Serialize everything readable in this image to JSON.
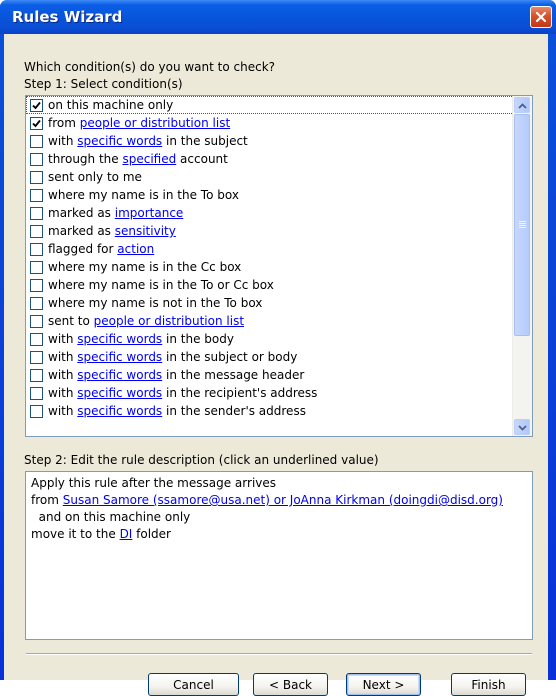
{
  "window": {
    "title": "Rules Wizard"
  },
  "prompt": "Which condition(s) do you want to check?",
  "step1": {
    "label": "Step 1: Select condition(s)"
  },
  "conditions": [
    {
      "checked": true,
      "parts": [
        "on this machine only"
      ]
    },
    {
      "checked": true,
      "parts": [
        "from ",
        {
          "link": "people or distribution list"
        }
      ]
    },
    {
      "checked": false,
      "parts": [
        "with ",
        {
          "link": "specific words"
        },
        " in the subject"
      ]
    },
    {
      "checked": false,
      "parts": [
        "through the ",
        {
          "link": "specified"
        },
        " account"
      ]
    },
    {
      "checked": false,
      "parts": [
        "sent only to me"
      ]
    },
    {
      "checked": false,
      "parts": [
        "where my name is in the To box"
      ]
    },
    {
      "checked": false,
      "parts": [
        "marked as ",
        {
          "link": "importance"
        }
      ]
    },
    {
      "checked": false,
      "parts": [
        "marked as ",
        {
          "link": "sensitivity"
        }
      ]
    },
    {
      "checked": false,
      "parts": [
        "flagged for ",
        {
          "link": "action"
        }
      ]
    },
    {
      "checked": false,
      "parts": [
        "where my name is in the Cc box"
      ]
    },
    {
      "checked": false,
      "parts": [
        "where my name is in the To or Cc box"
      ]
    },
    {
      "checked": false,
      "parts": [
        "where my name is not in the To box"
      ]
    },
    {
      "checked": false,
      "parts": [
        "sent to ",
        {
          "link": "people or distribution list"
        }
      ]
    },
    {
      "checked": false,
      "parts": [
        "with ",
        {
          "link": "specific words"
        },
        " in the body"
      ]
    },
    {
      "checked": false,
      "parts": [
        "with ",
        {
          "link": "specific words"
        },
        " in the subject or body"
      ]
    },
    {
      "checked": false,
      "parts": [
        "with ",
        {
          "link": "specific words"
        },
        " in the message header"
      ]
    },
    {
      "checked": false,
      "parts": [
        "with ",
        {
          "link": "specific words"
        },
        " in the recipient's address"
      ]
    },
    {
      "checked": false,
      "parts": [
        "with ",
        {
          "link": "specific words"
        },
        " in the sender's address"
      ]
    }
  ],
  "step2": {
    "label": "Step 2: Edit the rule description (click an underlined value)",
    "lines": [
      {
        "parts": [
          "Apply this rule after the message arrives"
        ]
      },
      {
        "parts": [
          "from ",
          {
            "link": "Susan Samore (ssamore@usa.net) or JoAnna Kirkman (doingdi@disd.org)"
          }
        ]
      },
      {
        "parts": [
          "  and on this machine only"
        ]
      },
      {
        "parts": [
          "move it to the ",
          {
            "link": "DI"
          },
          " folder"
        ]
      }
    ]
  },
  "buttons": {
    "cancel": "Cancel",
    "back": "< Back",
    "next": "Next >",
    "finish": "Finish"
  },
  "icons": {
    "close": "close-icon",
    "check": "checkmark-icon",
    "scroll_up": "scroll-up-arrow-icon",
    "scroll_down": "scroll-down-arrow-icon"
  }
}
